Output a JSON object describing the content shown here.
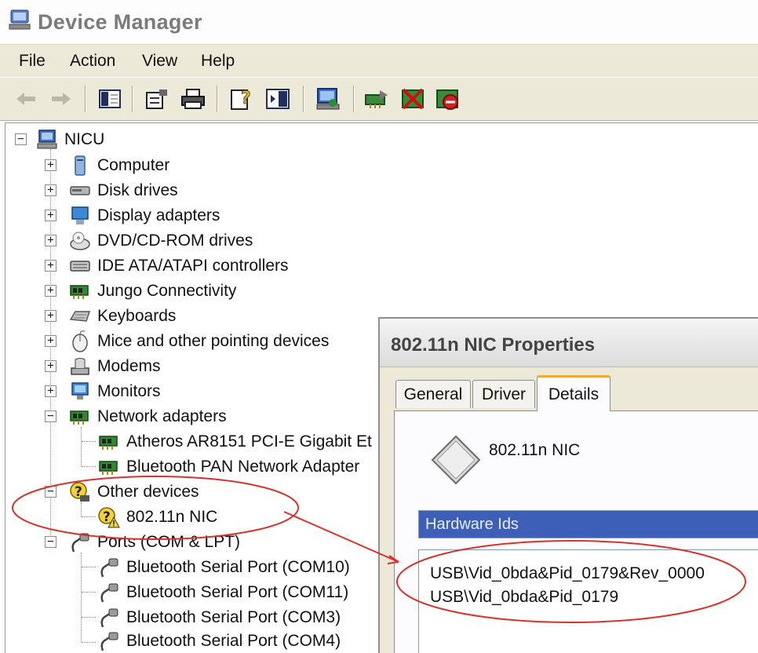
{
  "window": {
    "title": "Device Manager",
    "menu": [
      "File",
      "Action",
      "View",
      "Help"
    ],
    "toolbar_icons": [
      "back-icon",
      "forward-icon",
      "show-hide-tree-icon",
      "properties-icon",
      "print-icon",
      "help-icon",
      "console-tree-icon",
      "scan-hardware-icon",
      "update-driver-icon",
      "disable-device-icon",
      "uninstall-device-icon"
    ]
  },
  "tree": {
    "root": "NICU",
    "categories": [
      {
        "label": "Computer",
        "icon": "computer-icon",
        "expanded": false
      },
      {
        "label": "Disk drives",
        "icon": "disk-drive-icon",
        "expanded": false
      },
      {
        "label": "Display adapters",
        "icon": "display-adapter-icon",
        "expanded": false
      },
      {
        "label": "DVD/CD-ROM drives",
        "icon": "dvd-drive-icon",
        "expanded": false
      },
      {
        "label": "IDE ATA/ATAPI controllers",
        "icon": "ide-controller-icon",
        "expanded": false
      },
      {
        "label": "Jungo Connectivity",
        "icon": "jungo-board-icon",
        "expanded": false
      },
      {
        "label": "Keyboards",
        "icon": "keyboard-icon",
        "expanded": false
      },
      {
        "label": "Mice and other pointing devices",
        "icon": "mouse-icon",
        "expanded": false
      },
      {
        "label": "Modems",
        "icon": "modem-icon",
        "expanded": false
      },
      {
        "label": "Monitors",
        "icon": "monitor-icon",
        "expanded": false
      },
      {
        "label": "Network adapters",
        "icon": "network-card-icon",
        "expanded": true,
        "children": [
          "Atheros AR8151 PCI-E Gigabit Et",
          "Bluetooth PAN Network Adapter"
        ]
      },
      {
        "label": "Other devices",
        "icon": "unknown-device-icon",
        "expanded": true,
        "children": [
          "802.11n NIC"
        ]
      },
      {
        "label": "Ports (COM & LPT)",
        "icon": "port-icon",
        "expanded": true,
        "children": [
          "Bluetooth Serial Port (COM10)",
          "Bluetooth Serial Port (COM11)",
          "Bluetooth Serial Port (COM3)",
          "Bluetooth Serial Port (COM4)"
        ]
      }
    ]
  },
  "dialog": {
    "title": "802.11n NIC Properties",
    "tabs": [
      "General",
      "Driver",
      "Details"
    ],
    "active_tab": "Details",
    "device_name": "802.11n NIC",
    "property_selected": "Hardware Ids",
    "values": [
      "USB\\Vid_0bda&Pid_0179&Rev_0000",
      "USB\\Vid_0bda&Pid_0179"
    ]
  },
  "colors": {
    "annotation_red": "#d8322c",
    "selection_blue": "#3d5fb8",
    "active_tab_orange": "#f2a93a",
    "xp_face": "#ece9d8"
  }
}
